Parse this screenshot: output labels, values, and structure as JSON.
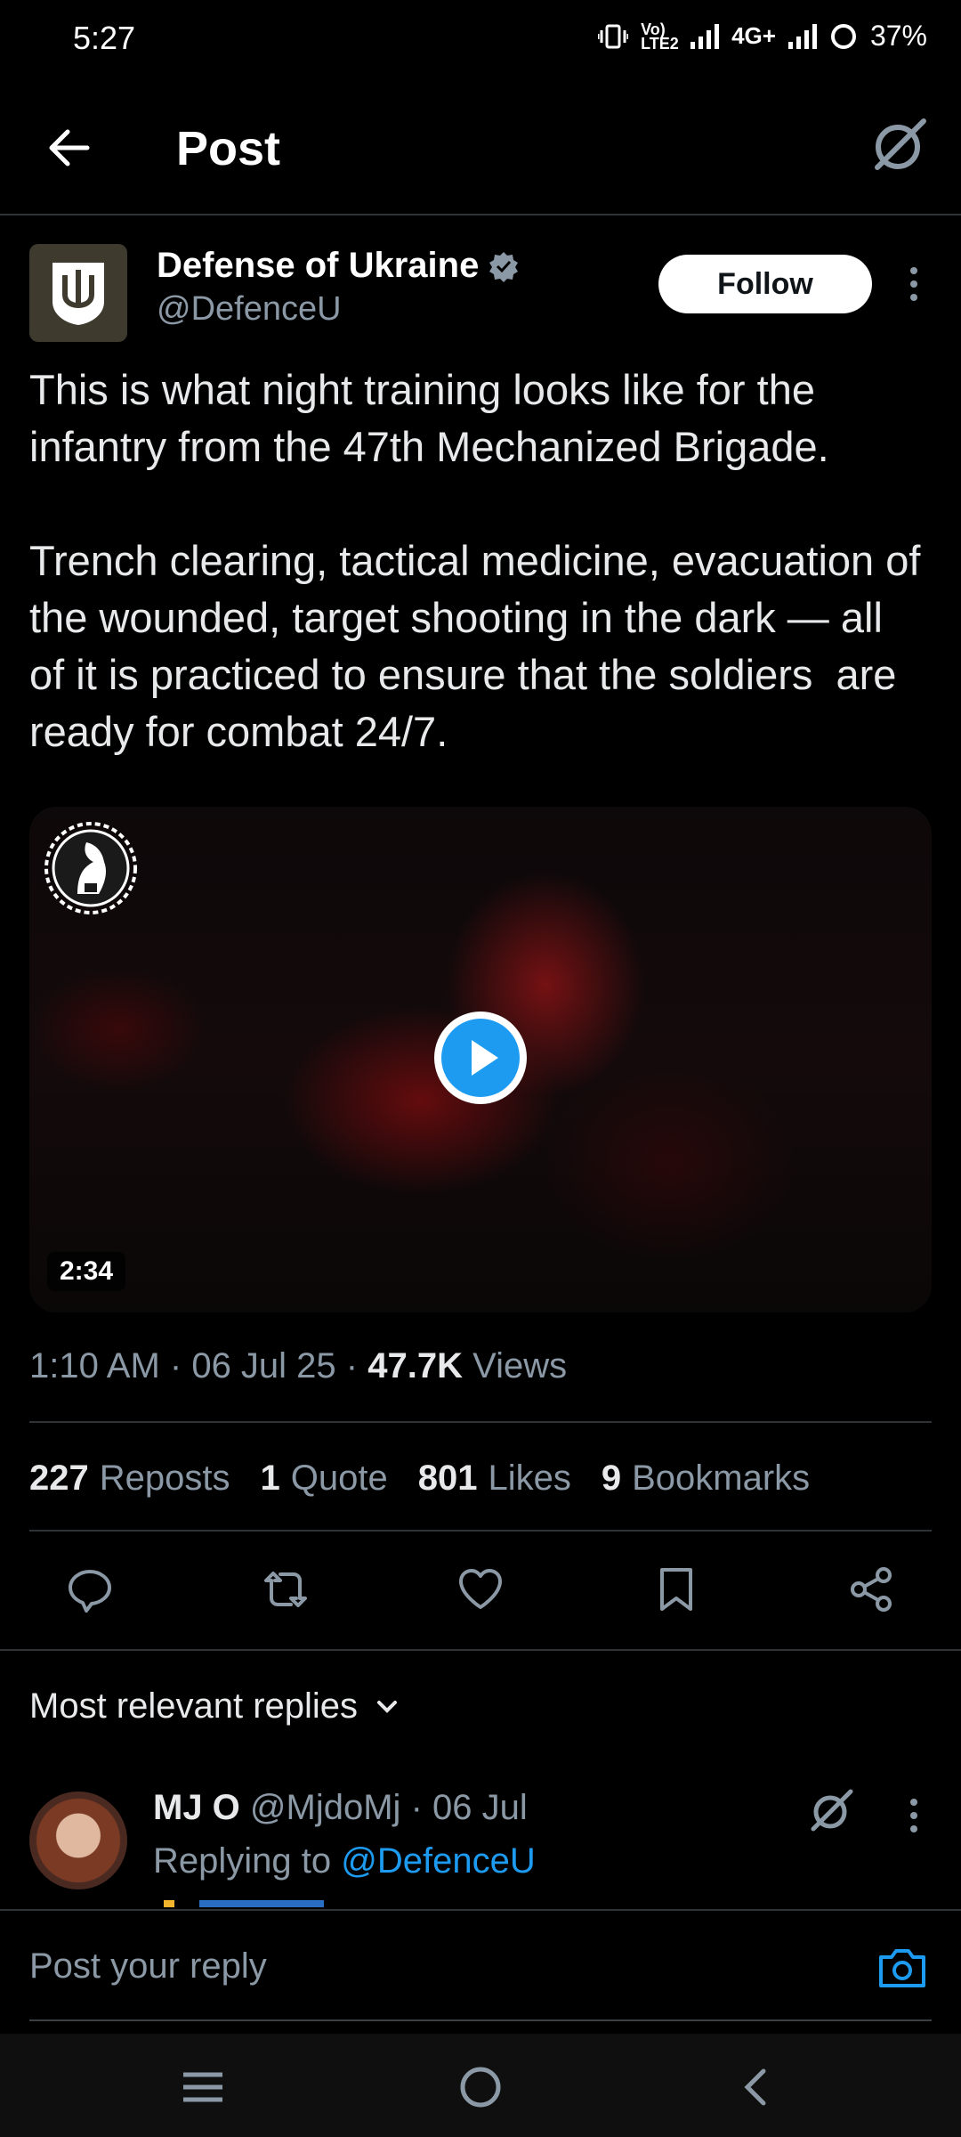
{
  "status_bar": {
    "time": "5:27",
    "network_badge": "Vo) LTE2",
    "network_type": "4G+",
    "battery": "37%"
  },
  "header": {
    "title": "Post",
    "back_icon": "arrow-left-icon",
    "grok_icon": "grok-icon"
  },
  "post": {
    "author_name": "Defense of Ukraine",
    "author_handle": "@DefenceU",
    "verified": true,
    "follow_label": "Follow",
    "text": "This is what night training looks like for the infantry from the 47th Mechanized Brigade.\n\nTrench clearing, tactical medicine, evacuation of the wounded, target shooting in the dark — all of it is practiced to ensure that the soldiers  are ready for combat 24/7.",
    "video": {
      "duration": "2:34"
    },
    "time": "1:10 AM",
    "date": "06 Jul 25",
    "views_count": "47.7K",
    "views_label": "Views",
    "stats": [
      {
        "count": "227",
        "label": "Reposts"
      },
      {
        "count": "1",
        "label": "Quote"
      },
      {
        "count": "801",
        "label": "Likes"
      },
      {
        "count": "9",
        "label": "Bookmarks"
      }
    ]
  },
  "replies": {
    "sort_label": "Most relevant replies",
    "items": [
      {
        "name": "MJ O",
        "handle": "@MjdoMj",
        "date": "06 Jul",
        "replying_to_label": "Replying to",
        "replying_to": "@DefenceU"
      }
    ]
  },
  "compose": {
    "placeholder": "Post your reply"
  },
  "colors": {
    "accent": "#1d9bf0",
    "background": "#000000",
    "secondary_text": "#8b98a5",
    "divider": "#2f3336"
  }
}
